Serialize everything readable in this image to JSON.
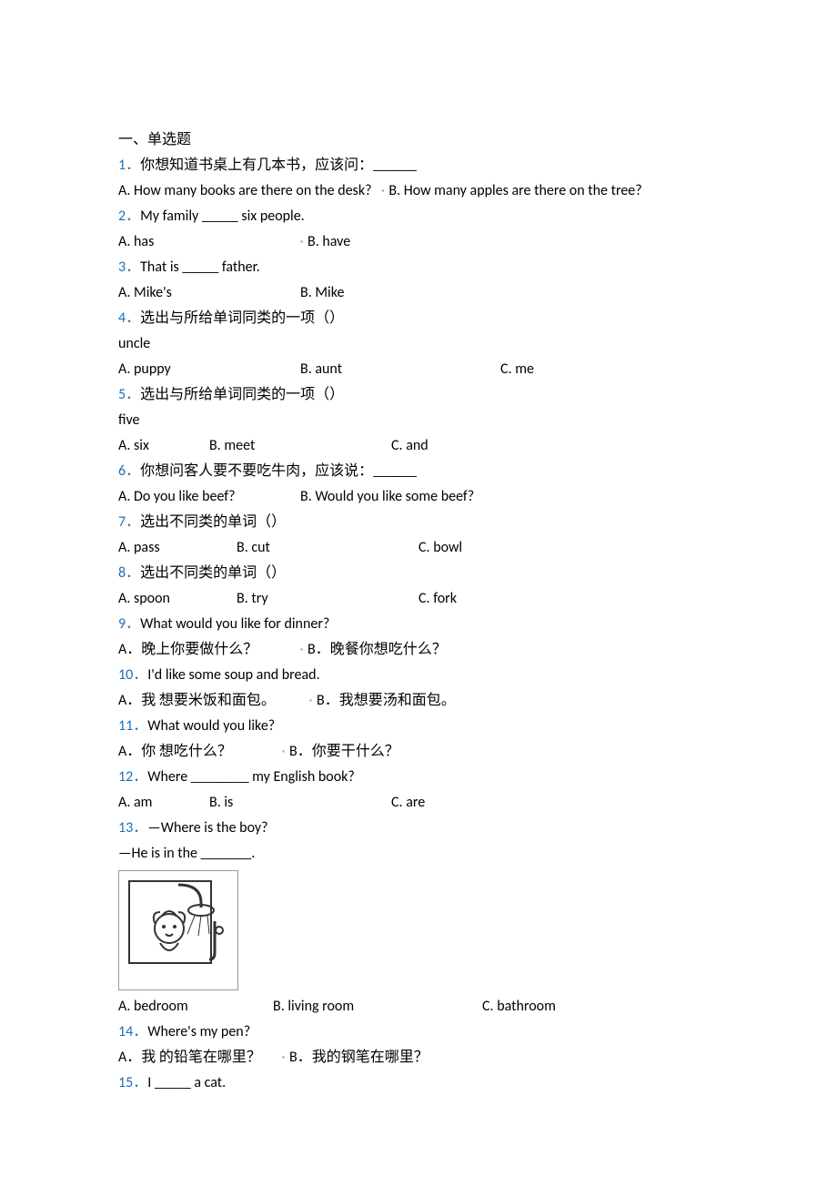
{
  "section_title": "一、单选题",
  "q1": {
    "num": "1．",
    "text": "你想知道书桌上有几本书，应该问：______",
    "a": "A. How many books are there on the desk?",
    "b": "B. How many apples are there on the tree?"
  },
  "q2": {
    "num": "2．",
    "text": "My family _____ six people.",
    "a": "A. has",
    "b": "B. have"
  },
  "q3": {
    "num": "3．",
    "text": "That is _____ father.",
    "a": "A. Mike's",
    "b": "B. Mike"
  },
  "q4": {
    "num": "4．",
    "text": "选出与所给单词同类的一项（）",
    "word": "uncle",
    "a": "A. puppy",
    "b": "B. aunt",
    "c": "C. me"
  },
  "q5": {
    "num": "5．",
    "text": "选出与所给单词同类的一项（）",
    "word": "five",
    "a": "A. six",
    "b": "B. meet",
    "c": "C. and"
  },
  "q6": {
    "num": "6．",
    "text": "你想问客人要不要吃牛肉，应该说：______",
    "a": "A. Do you like beef?",
    "b": "B. Would you like some beef?"
  },
  "q7": {
    "num": "7．",
    "text": "选出不同类的单词（）",
    "a": "A. pass",
    "b": "B. cut",
    "c": "C. bowl"
  },
  "q8": {
    "num": "8．",
    "text": "选出不同类的单词（）",
    "a": "A. spoon",
    "b": "B. try",
    "c": "C. fork"
  },
  "q9": {
    "num": "9．",
    "text": "What would you like for dinner?",
    "a": "A．晚上你要做什么？",
    "b": "B．晚餐你想吃什么？"
  },
  "q10": {
    "num": "10．",
    "text": "I'd like some soup and bread.",
    "a": "A．我 想要米饭和面包。",
    "b": "B．我想要汤和面包。"
  },
  "q11": {
    "num": "11．",
    "text": "What would you like?",
    "a": "A．你 想吃什么？",
    "b": "B．你要干什么？"
  },
  "q12": {
    "num": "12．",
    "text": "Where ________ my English book?",
    "a": "A. am",
    "b": "B. is",
    "c": "C. are"
  },
  "q13": {
    "num": "13．",
    "text": "—Where is the boy?",
    "line2": "—He is in the _______.",
    "a": "A. bedroom",
    "b": "B. living room",
    "c": "C. bathroom"
  },
  "q14": {
    "num": "14．",
    "text": "Where's my pen?",
    "a": "A．我 的铅笔在哪里？",
    "b": "B．我的钢笔在哪里？"
  },
  "q15": {
    "num": "15．",
    "text": "I _____ a cat."
  }
}
